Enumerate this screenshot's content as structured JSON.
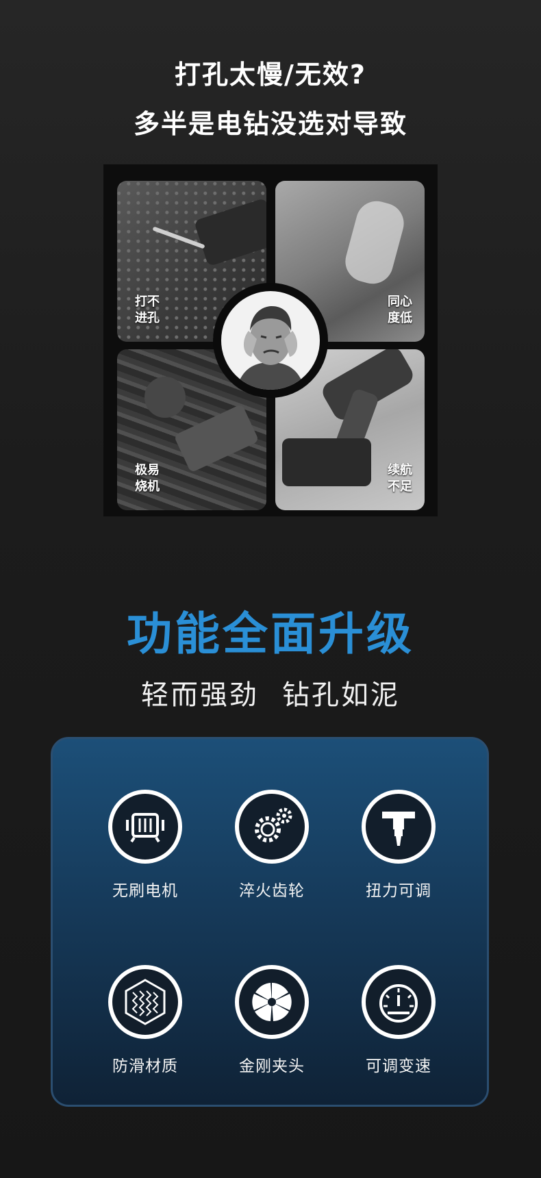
{
  "header": {
    "line1": "打孔太慢/无效?",
    "line2": "多半是电钻没选对导致"
  },
  "collage": {
    "panels": [
      {
        "label": "打不\n进孔"
      },
      {
        "label": "同心\n度低"
      },
      {
        "label": "极易\n烧机"
      },
      {
        "label": "续航\n不足"
      }
    ]
  },
  "upgrade": {
    "title": "功能全面升级",
    "subtitle_a": "轻而强劲",
    "subtitle_b": "钻孔如泥",
    "title_color": "#2a8fd6"
  },
  "features": [
    {
      "label": "无刷电机",
      "icon": "brushless-motor-icon"
    },
    {
      "label": "淬火齿轮",
      "icon": "gears-icon"
    },
    {
      "label": "扭力可调",
      "icon": "torque-drill-icon"
    },
    {
      "label": "防滑材质",
      "icon": "anti-slip-texture-icon"
    },
    {
      "label": "金刚夹头",
      "icon": "chuck-icon"
    },
    {
      "label": "可调变速",
      "icon": "speedometer-icon"
    }
  ]
}
